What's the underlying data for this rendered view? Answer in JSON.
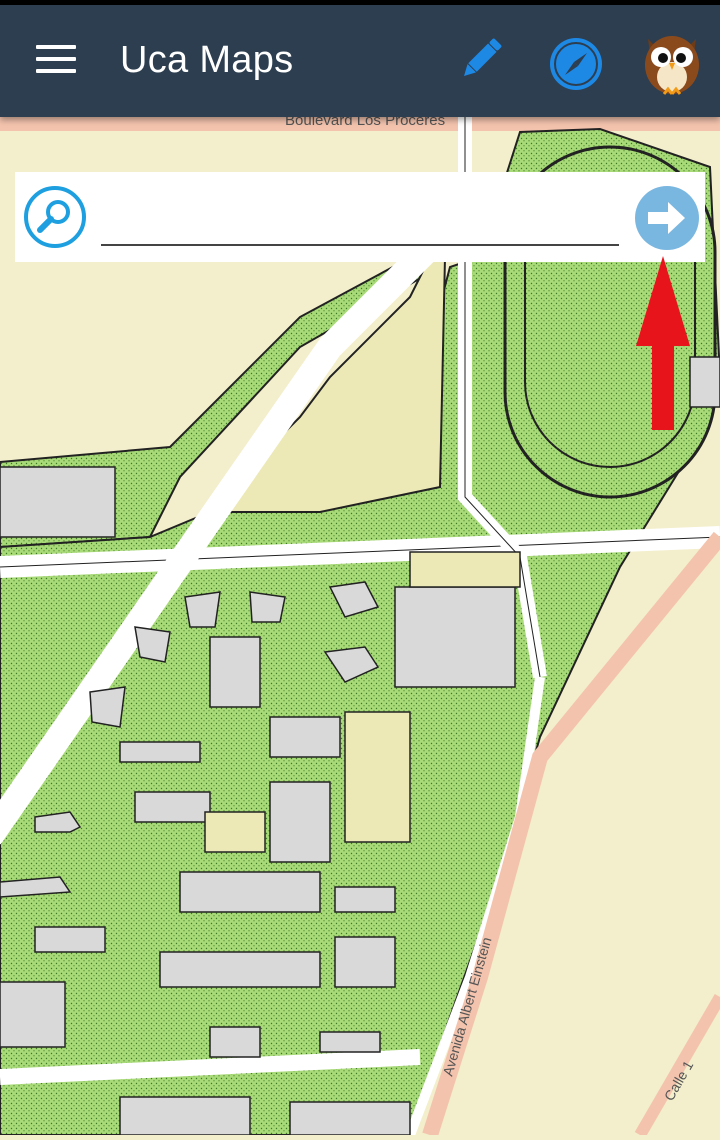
{
  "app": {
    "title": "Uca Maps"
  },
  "toolbar": {
    "menu_icon": "hamburger-menu-icon",
    "edit_icon": "pencil-icon",
    "compass_icon": "compass-icon",
    "avatar_icon": "owl-avatar-icon"
  },
  "search": {
    "value": "",
    "placeholder": "",
    "search_icon": "magnifier-icon",
    "go_icon": "arrow-right-circle-icon"
  },
  "annotation": {
    "color": "#e8141c",
    "icon": "red-up-arrow"
  },
  "map": {
    "labels": {
      "boulevard": "Boulevard Los Próceres",
      "avenida": "Avenida Albert Einstein",
      "calle": "Calle 1"
    }
  },
  "colors": {
    "appbar": "#2c3e50",
    "map_bg": "#f3eecb",
    "park": "#a6d874",
    "building": "#d9d9d9",
    "accent": "#1ea0e0",
    "road_edge": "#f2c4a8"
  }
}
